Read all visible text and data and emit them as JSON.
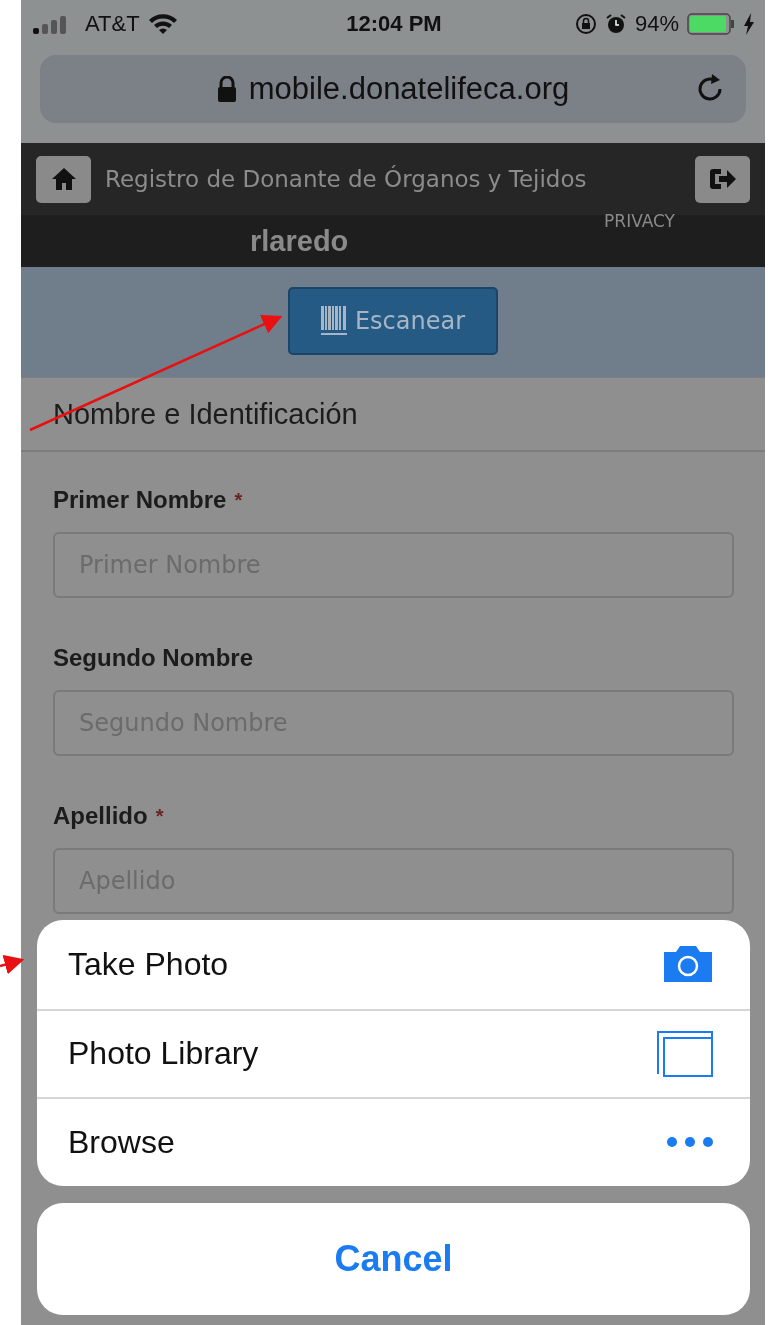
{
  "status_bar": {
    "carrier": "AT&T",
    "time": "12:04 PM",
    "battery": "94%"
  },
  "address_bar": {
    "url": "mobile.donatelifeca.org"
  },
  "header": {
    "title": "Registro de Donante de Órganos y Tejidos",
    "privacy": "PRIVACY",
    "user": "rlaredo"
  },
  "scan_button": {
    "label": "Escanear"
  },
  "form": {
    "section_title": "Nombre e Identificación",
    "fields": [
      {
        "label": "Primer Nombre",
        "required_mark": "*",
        "placeholder": "Primer Nombre"
      },
      {
        "label": "Segundo Nombre",
        "placeholder": "Segundo Nombre"
      },
      {
        "label": "Apellido",
        "required_mark": "*",
        "placeholder": "Apellido"
      }
    ]
  },
  "action_sheet": {
    "options": [
      {
        "label": "Take Photo",
        "kind": "camera"
      },
      {
        "label": "Photo Library",
        "kind": "library"
      },
      {
        "label": "Browse",
        "kind": "more"
      }
    ],
    "cancel": "Cancel"
  }
}
